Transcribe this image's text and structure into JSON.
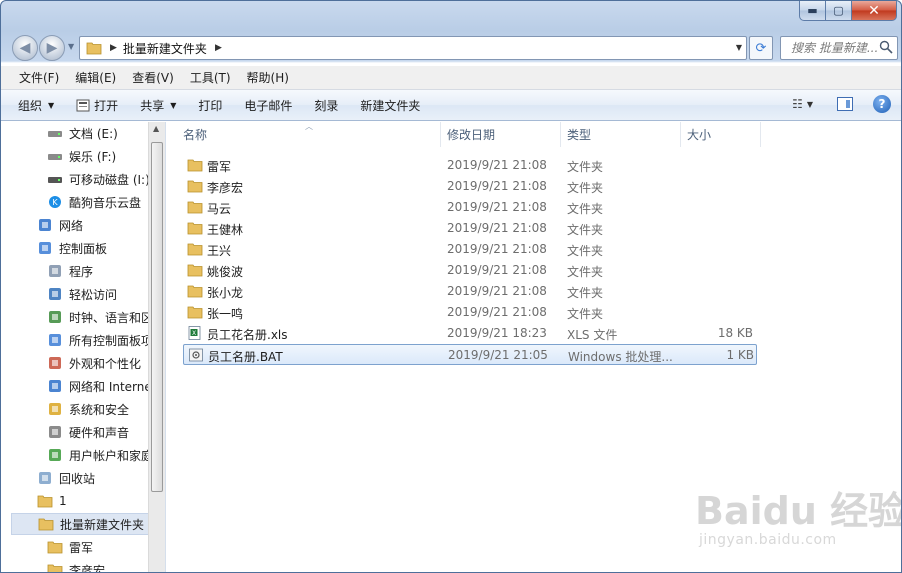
{
  "window": {
    "caption_buttons": {
      "minimize": "▬",
      "maximize": "▢",
      "close": "✕"
    }
  },
  "address_bar": {
    "path": "批量新建文件夹",
    "search_placeholder": "搜索 批量新建..."
  },
  "menu": [
    "文件(F)",
    "编辑(E)",
    "查看(V)",
    "工具(T)",
    "帮助(H)"
  ],
  "commands": {
    "organize": "组织",
    "open": "打开",
    "share": "共享",
    "print": "打印",
    "email": "电子邮件",
    "burn": "刻录",
    "new_folder": "新建文件夹"
  },
  "nav_pane": {
    "items": [
      {
        "label": "文档 (E:)",
        "icon": "drive-icon"
      },
      {
        "label": "娱乐 (F:)",
        "icon": "drive-icon"
      },
      {
        "label": "可移动磁盘 (I:)",
        "icon": "removable-drive-icon"
      },
      {
        "label": "酷狗音乐云盘",
        "icon": "kugou-icon"
      },
      {
        "label": "网络",
        "icon": "network-icon"
      },
      {
        "label": "控制面板",
        "icon": "control-panel-icon"
      },
      {
        "label": "程序",
        "icon": "programs-icon"
      },
      {
        "label": "轻松访问",
        "icon": "ease-of-access-icon"
      },
      {
        "label": "时钟、语言和区",
        "icon": "clock-language-icon"
      },
      {
        "label": "所有控制面板项",
        "icon": "all-control-panel-icon"
      },
      {
        "label": "外观和个性化",
        "icon": "appearance-icon"
      },
      {
        "label": "网络和 Interne",
        "icon": "network-internet-icon"
      },
      {
        "label": "系统和安全",
        "icon": "system-security-icon"
      },
      {
        "label": "硬件和声音",
        "icon": "hardware-sound-icon"
      },
      {
        "label": "用户帐户和家庭",
        "icon": "user-accounts-icon"
      },
      {
        "label": "回收站",
        "icon": "recycle-bin-icon"
      },
      {
        "label": "1",
        "icon": "folder-icon"
      },
      {
        "label": "批量新建文件夹",
        "icon": "folder-icon"
      },
      {
        "label": "雷军",
        "icon": "folder-icon"
      },
      {
        "label": "李彦宏",
        "icon": "folder-icon"
      }
    ]
  },
  "columns": {
    "name": "名称",
    "date": "修改日期",
    "type": "类型",
    "size": "大小"
  },
  "files": [
    {
      "name": "雷军",
      "date": "2019/9/21 21:08",
      "type": "文件夹",
      "size": "",
      "icon": "folder-icon"
    },
    {
      "name": "李彦宏",
      "date": "2019/9/21 21:08",
      "type": "文件夹",
      "size": "",
      "icon": "folder-icon"
    },
    {
      "name": "马云",
      "date": "2019/9/21 21:08",
      "type": "文件夹",
      "size": "",
      "icon": "folder-icon"
    },
    {
      "name": "王健林",
      "date": "2019/9/21 21:08",
      "type": "文件夹",
      "size": "",
      "icon": "folder-icon"
    },
    {
      "name": "王兴",
      "date": "2019/9/21 21:08",
      "type": "文件夹",
      "size": "",
      "icon": "folder-icon"
    },
    {
      "name": "姚俊波",
      "date": "2019/9/21 21:08",
      "type": "文件夹",
      "size": "",
      "icon": "folder-icon"
    },
    {
      "name": "张小龙",
      "date": "2019/9/21 21:08",
      "type": "文件夹",
      "size": "",
      "icon": "folder-icon"
    },
    {
      "name": "张一鸣",
      "date": "2019/9/21 21:08",
      "type": "文件夹",
      "size": "",
      "icon": "folder-icon"
    },
    {
      "name": "员工花名册.xls",
      "date": "2019/9/21 18:23",
      "type": "XLS 文件",
      "size": "18 KB",
      "icon": "excel-file-icon"
    },
    {
      "name": "员工名册.BAT",
      "date": "2019/9/21 21:05",
      "type": "Windows 批处理...",
      "size": "1 KB",
      "icon": "batch-file-icon"
    }
  ],
  "watermark": {
    "logo": "Baidu 经验",
    "url": "jingyan.baidu.com"
  }
}
